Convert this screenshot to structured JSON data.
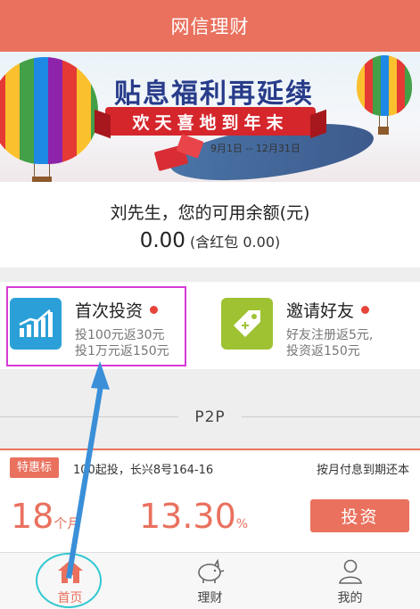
{
  "header": {
    "title": "网信理财"
  },
  "banner": {
    "headline": "贴息福利再延续",
    "ribbon": "欢天喜地到年末",
    "dates": "9月1日 -- 12月31日",
    "dots_count": 3,
    "active_dot": 0
  },
  "balance": {
    "label": "刘先生，您的可用余额(元)",
    "amount": "0.00",
    "redpacket": "(含红包 0.00)"
  },
  "features": [
    {
      "title": "首次投资",
      "line1": "投100元返30元",
      "line2": "投1万元返150元",
      "icon": "chart-icon"
    },
    {
      "title": "邀请好友",
      "line1": "好友注册返5元,",
      "line2": "投资返150元",
      "icon": "tag-icon"
    }
  ],
  "section": {
    "label": "P2P"
  },
  "product": {
    "tag": "特惠标",
    "desc": "100起投，长兴8号164-16",
    "repayment": "按月付息到期还本",
    "term_value": "18",
    "term_unit": "个月",
    "rate_value": "13.30",
    "rate_unit": "%",
    "button": "投资"
  },
  "tabbar": [
    {
      "label": "首页",
      "icon": "home-icon",
      "active": true
    },
    {
      "label": "理财",
      "icon": "piggy-bank-icon",
      "active": false
    },
    {
      "label": "我的",
      "icon": "user-icon",
      "active": false
    }
  ],
  "colors": {
    "brand": "#e9715e",
    "highlight_box": "#d63ad6",
    "circle_mark": "#30c8d0",
    "arrow": "#3a8fd8"
  }
}
